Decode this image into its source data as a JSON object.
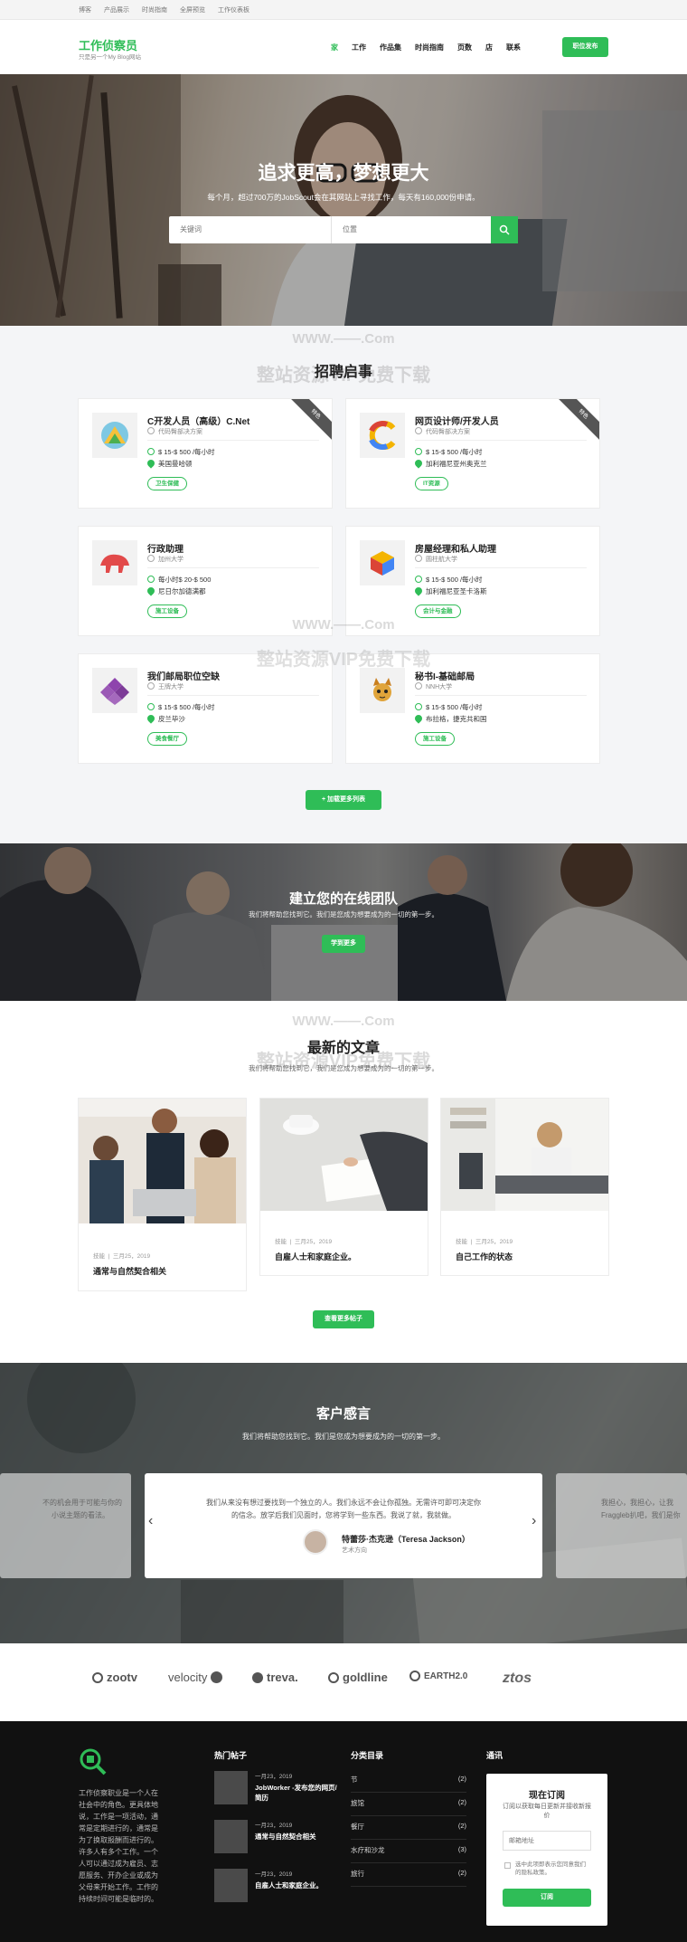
{
  "topbar": {
    "links": [
      "博客",
      "产品展示",
      "时尚指南",
      "全屏预览",
      "工作仪表板"
    ]
  },
  "header": {
    "logo": "工作侦察员",
    "tagline": "只是另一个My Blog网站",
    "nav": [
      "家",
      "工作",
      "作品集",
      "时尚指南",
      "页数",
      "店",
      "联系"
    ],
    "post_job": "职位发布"
  },
  "hero": {
    "title": "追求更高，梦想更大",
    "subtitle": "每个月，超过700万的JobScout会在其网站上寻找工作，每天有160,000份申请。",
    "keyword_placeholder": "关键词",
    "location_placeholder": "位置"
  },
  "watermark": {
    "line1": "WWW.——.Com",
    "line2": "整站资源VIP免费下载"
  },
  "jobs_section": {
    "title": "招聘启事",
    "load_more": "+ 加载更多列表"
  },
  "jobs": [
    {
      "title": "C开发人员（高级）C.Net",
      "company": "代码臀部决方案",
      "salary": "$ 15-$ 500 /每小时",
      "location": "美国曼哈顿",
      "tag": "卫生保健",
      "featured": "特色"
    },
    {
      "title": "网页设计师/开发人员",
      "company": "代码臀部决方案",
      "salary": "$ 15-$ 500 /每小时",
      "location": "加利福尼亚州奥克兰",
      "tag": "IT资源",
      "featured": "特色"
    },
    {
      "title": "行政助理",
      "company": "加州大学",
      "salary": "每小时$ 20-$ 500",
      "location": "尼日尔加德满都",
      "tag": "施工设备",
      "featured": ""
    },
    {
      "title": "房屋经理和私人助理",
      "company": "圆柱航大学",
      "salary": "$ 15-$ 500 /每小时",
      "location": "加利福尼亚圣卡洛斯",
      "tag": "会计与金融",
      "featured": ""
    },
    {
      "title": "我们邮局职位空缺",
      "company": "王牌大学",
      "salary": "$ 15-$ 500 /每小时",
      "location": "皮兰毕沙",
      "tag": "美食餐厅",
      "featured": ""
    },
    {
      "title": "秘书I-基础邮局",
      "company": "NNH大学",
      "salary": "$ 15-$ 500 /每小时",
      "location": "布拉格，捷克共和国",
      "tag": "施工设备",
      "featured": ""
    }
  ],
  "team": {
    "title": "建立您的在线团队",
    "subtitle": "我们将帮助您找到它。我们是您成为想要成为的一切的第一步。",
    "button": "学到更多"
  },
  "articles": {
    "title": "最新的文章",
    "subtitle": "我们将帮助您找到它，我们是您成为想要成为的一切的第一步。",
    "more": "查看更多帖子",
    "posts": [
      {
        "category": "技能",
        "date": "三月25，2019",
        "title": "通常与自然契合相关"
      },
      {
        "category": "技能",
        "date": "三月25，2019",
        "title": "自雇人士和家庭企业。"
      },
      {
        "category": "技能",
        "date": "三月25，2019",
        "title": "自己工作的状态"
      }
    ]
  },
  "testimonials": {
    "title": "客户感言",
    "subtitle": "我们将帮助您找到它。我们是您成为想要成为的一切的第一步。",
    "left_text_1": "不的机会用于可能与你的",
    "left_text_2": "小说主题的看法。",
    "quote_1": "我们从来没有想过要找到一个独立的人。我们永远不会让你孤独。无需许可即可决定你",
    "quote_2": "的信念。放学后我们见面时，您将学到一些东西。我说了就，我就做。",
    "author": "特蕾莎·杰克逊（Teresa Jackson）",
    "role": "艺术方向",
    "right_text_1": "我担心，我担心，让我",
    "right_text_2": "Fraggleb扒吧，我们是你",
    "prev": "‹",
    "next": "›"
  },
  "partners": [
    "zootv",
    "velocity",
    "treva.",
    "goldline",
    "EARTH2.0",
    "ztos"
  ],
  "footer": {
    "about": "工作侦察职业是一个人在社会中的角色。更具体地说，工作是一项活动，通常是定期进行的，通常是为了换取报酬而进行的。许多人有多个工作。一个人可以通过成为雇员、志愿服务、开办企业或成为父母来开始工作。工作的持续时间可能是临时的。",
    "hot_posts_title": "热门帖子",
    "hot_posts": [
      {
        "date": "一月23，2019",
        "title": "JobWorker -发布您的网页/简历"
      },
      {
        "date": "一月23，2019",
        "title": "通常与自然契合相关"
      },
      {
        "date": "一月23，2019",
        "title": "自雇人士和家庭企业。"
      }
    ],
    "cats_title": "分类目录",
    "cats": [
      {
        "name": "节",
        "count": "(2)"
      },
      {
        "name": "旅馆",
        "count": "(2)"
      },
      {
        "name": "餐厅",
        "count": "(2)"
      },
      {
        "name": "水疗和沙龙",
        "count": "(3)"
      },
      {
        "name": "旅行",
        "count": "(2)"
      }
    ],
    "newsletter_title": "通讯",
    "sub_title": "现在订阅",
    "sub_text": "订阅以获取每日更新并接收新报价",
    "email_placeholder": "邮箱地址",
    "consent": "选中此项即表示您同意我们的隐私政策。",
    "sub_button": "订阅"
  }
}
